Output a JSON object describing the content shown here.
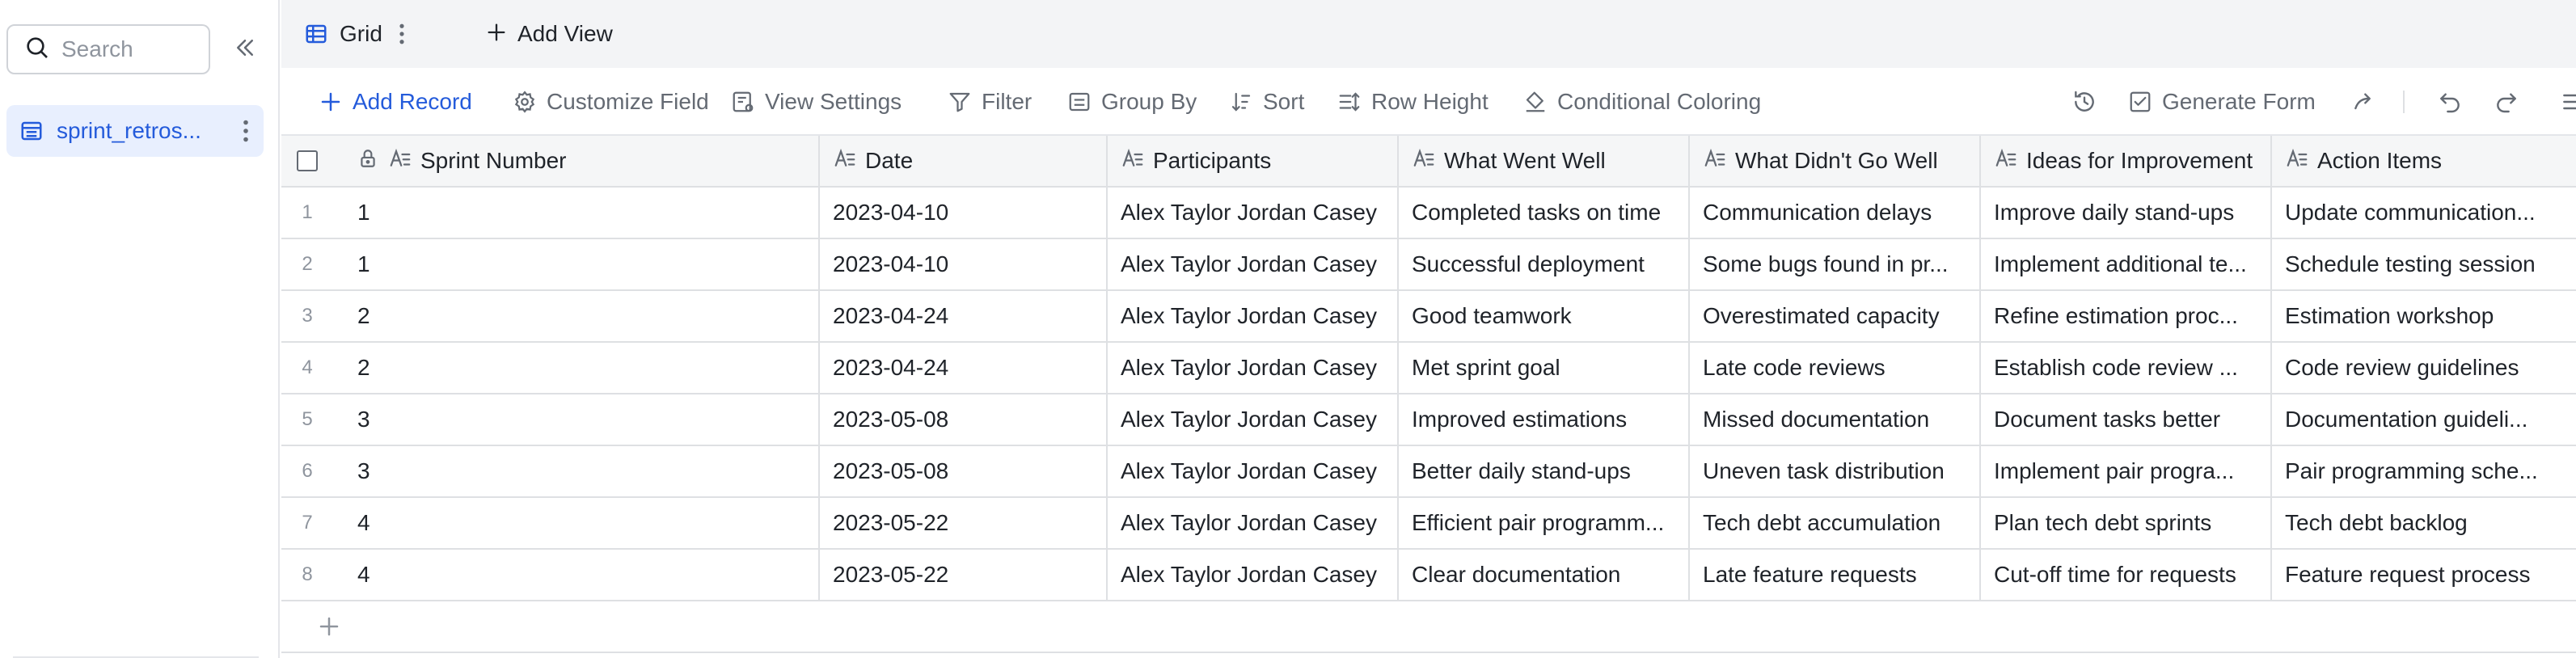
{
  "sidebar": {
    "search_placeholder": "Search",
    "items": [
      {
        "label": "sprint_retros..."
      }
    ]
  },
  "tabs": {
    "active": "Grid",
    "add_view": "Add View"
  },
  "toolbar": {
    "add_record": "Add Record",
    "customize_field": "Customize Field",
    "view_settings": "View Settings",
    "filter": "Filter",
    "group_by": "Group By",
    "sort": "Sort",
    "row_height": "Row Height",
    "conditional_coloring": "Conditional Coloring",
    "generate_form": "Generate Form"
  },
  "table": {
    "columns": [
      "Sprint Number",
      "Date",
      "Participants",
      "What Went Well",
      "What Didn't Go Well",
      "Ideas for Improvement",
      "Action Items"
    ],
    "rows": [
      {
        "num": "1",
        "cells": [
          "1",
          "2023-04-10",
          "Alex Taylor Jordan Casey",
          "Completed tasks on time",
          "Communication delays",
          "Improve daily stand-ups",
          "Update communication..."
        ]
      },
      {
        "num": "2",
        "cells": [
          "1",
          "2023-04-10",
          "Alex Taylor Jordan Casey",
          "Successful deployment",
          "Some bugs found in pr...",
          "Implement additional te...",
          "Schedule testing session"
        ]
      },
      {
        "num": "3",
        "cells": [
          "2",
          "2023-04-24",
          "Alex Taylor Jordan Casey",
          "Good teamwork",
          "Overestimated capacity",
          "Refine estimation proc...",
          "Estimation workshop"
        ]
      },
      {
        "num": "4",
        "cells": [
          "2",
          "2023-04-24",
          "Alex Taylor Jordan Casey",
          "Met sprint goal",
          "Late code reviews",
          "Establish code review ...",
          "Code review guidelines"
        ]
      },
      {
        "num": "5",
        "cells": [
          "3",
          "2023-05-08",
          "Alex Taylor Jordan Casey",
          "Improved estimations",
          "Missed documentation",
          "Document tasks better",
          "Documentation guideli..."
        ]
      },
      {
        "num": "6",
        "cells": [
          "3",
          "2023-05-08",
          "Alex Taylor Jordan Casey",
          "Better daily stand-ups",
          "Uneven task distribution",
          "Implement pair progra...",
          "Pair programming sche..."
        ]
      },
      {
        "num": "7",
        "cells": [
          "4",
          "2023-05-22",
          "Alex Taylor Jordan Casey",
          "Efficient pair programm...",
          "Tech debt accumulation",
          "Plan tech debt sprints",
          "Tech debt backlog"
        ]
      },
      {
        "num": "8",
        "cells": [
          "4",
          "2023-05-22",
          "Alex Taylor Jordan Casey",
          "Clear documentation",
          "Late feature requests",
          "Cut-off time for requests",
          "Feature request process"
        ]
      }
    ]
  },
  "colors": {
    "accent": "#245bdb",
    "selected_bg": "#e8effe",
    "border": "#dee0e3",
    "muted_text": "#646a73"
  }
}
